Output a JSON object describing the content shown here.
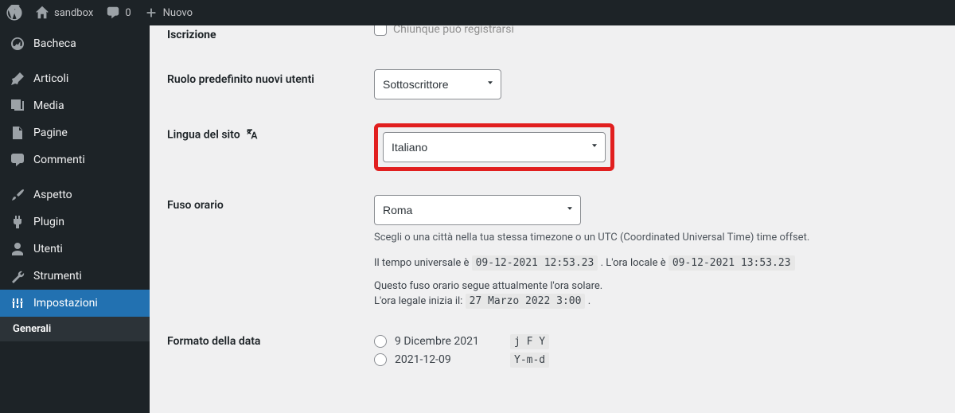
{
  "adminbar": {
    "site_name": "sandbox",
    "comments_count": "0",
    "new_label": "Nuovo"
  },
  "menu": {
    "dashboard": "Bacheca",
    "posts": "Articoli",
    "media": "Media",
    "pages": "Pagine",
    "comments": "Commenti",
    "appearance": "Aspetto",
    "plugins": "Plugin",
    "users": "Utenti",
    "tools": "Strumenti",
    "settings": "Impostazioni",
    "settings_general": "Generali"
  },
  "settings": {
    "subscription_label": "Iscrizione",
    "subscription_checkbox": "Chiunque può registrarsi",
    "default_role_label": "Ruolo predefinito nuovi utenti",
    "default_role_value": "Sottoscrittore",
    "language_label": "Lingua del sito",
    "language_value": "Italiano",
    "timezone_label": "Fuso orario",
    "timezone_value": "Roma",
    "timezone_desc": "Scegli o una città nella tua stessa timezone o un UTC (Coordinated Universal Time) time offset.",
    "utc_prefix": "Il tempo universale è ",
    "utc_value": "09-12-2021 12:53.23",
    "local_prefix": " . L'ora locale è ",
    "local_value": "09-12-2021 13:53.23",
    "dst_line1": "Questo fuso orario segue attualmente l'ora solare.",
    "dst_line2_prefix": "L'ora legale inizia il: ",
    "dst_line2_value": "27 Marzo 2022 3:00",
    "dst_line2_suffix": " .",
    "date_format_label": "Formato della data",
    "date_opt1_example": "9 Dicembre 2021",
    "date_opt1_format": "j F Y",
    "date_opt2_example": "2021-12-09",
    "date_opt2_format": "Y-m-d"
  }
}
